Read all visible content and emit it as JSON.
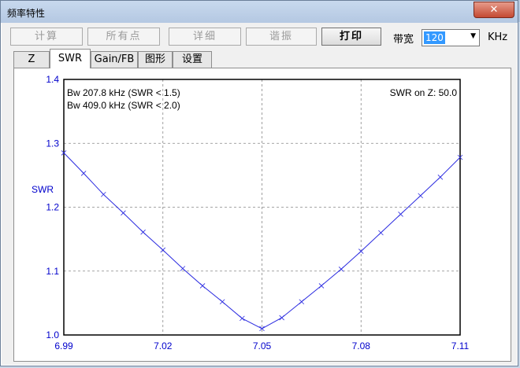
{
  "window": {
    "title": "频率特性",
    "close_glyph": "✕"
  },
  "toolbar": {
    "buttons": [
      {
        "label": "计算",
        "enabled": false
      },
      {
        "label": "所有点",
        "enabled": false
      },
      {
        "label": "详细",
        "enabled": false
      },
      {
        "label": "谐振",
        "enabled": false
      },
      {
        "label": "打印",
        "enabled": true
      }
    ],
    "bandwidth_label": "带宽",
    "bandwidth_value": "120",
    "unit": "KHz"
  },
  "tabs": [
    {
      "label": "Z",
      "active": false
    },
    {
      "label": "SWR",
      "active": true
    },
    {
      "label": "Gain/FB",
      "active": false
    },
    {
      "label": "图形",
      "active": false
    },
    {
      "label": "设置",
      "active": false
    }
  ],
  "colors": {
    "axis_text": "#0000cc",
    "curve": "#2a2ae0",
    "grid": "#888888"
  },
  "chart_data": {
    "type": "line",
    "ylabel": "SWR",
    "xlabel": "",
    "xlim": [
      6.99,
      7.11
    ],
    "ylim": [
      1.0,
      1.4
    ],
    "x_ticks": [
      "6.99",
      "7.02",
      "7.05",
      "7.08",
      "7.11"
    ],
    "y_ticks": [
      "1.0",
      "1.1",
      "1.2",
      "1.3",
      "1.4"
    ],
    "annotations": {
      "bw1": "Bw 207.8 kHz (SWR < 1.5)",
      "bw2": "Bw 409.0 kHz (SWR < 2.0)",
      "ref": "SWR on Z: 50.0"
    },
    "series": [
      {
        "x": [
          6.99,
          6.996,
          7.002,
          7.008,
          7.014,
          7.02,
          7.026,
          7.032,
          7.038,
          7.044,
          7.05,
          7.056,
          7.062,
          7.068,
          7.074,
          7.08,
          7.086,
          7.092,
          7.098,
          7.104,
          7.11
        ],
        "y": [
          1.285,
          1.253,
          1.22,
          1.191,
          1.161,
          1.133,
          1.104,
          1.077,
          1.052,
          1.026,
          1.01,
          1.027,
          1.052,
          1.077,
          1.103,
          1.131,
          1.16,
          1.189,
          1.218,
          1.247,
          1.278
        ]
      }
    ]
  }
}
